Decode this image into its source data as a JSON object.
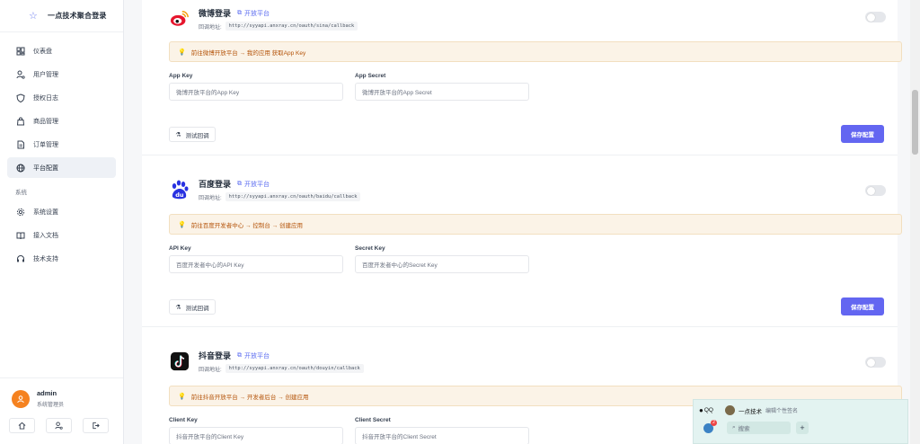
{
  "app": {
    "name": "一点技术聚合登录",
    "logo_icon": "star-icon"
  },
  "sidebar": {
    "items": [
      {
        "label": "仪表盘",
        "icon": "dashboard-icon"
      },
      {
        "label": "用户管理",
        "icon": "user-gear-icon"
      },
      {
        "label": "授权日志",
        "icon": "shield-icon"
      },
      {
        "label": "商品管理",
        "icon": "bag-icon"
      },
      {
        "label": "订单管理",
        "icon": "document-icon"
      },
      {
        "label": "平台配置",
        "icon": "globe-icon",
        "active": true
      }
    ],
    "group_label": "系统",
    "system_items": [
      {
        "label": "系统设置",
        "icon": "gear-icon"
      },
      {
        "label": "接入文档",
        "icon": "book-icon"
      },
      {
        "label": "技术支持",
        "icon": "headset-icon"
      }
    ],
    "user": {
      "name": "admin",
      "role": "系统管理员"
    }
  },
  "common": {
    "open_platform": "开放平台",
    "callback_label": "回调地址:",
    "test_callback": "测试回调",
    "save_config": "保存配置"
  },
  "platforms": [
    {
      "title": "微博登录",
      "callback_url": "http://syyapi.anxray.cn/oauth/sina/callback",
      "tip": "前往微博开放平台 → 我的应用 获取App Key",
      "field1_label": "App Key",
      "field1_placeholder": "微博开放平台的App Key",
      "field2_label": "App Secret",
      "field2_placeholder": "微博开放平台的App Secret",
      "enabled": false
    },
    {
      "title": "百度登录",
      "callback_url": "http://syyapi.anxray.cn/oauth/baidu/callback",
      "tip": "前往百度开发者中心 → 控制台 → 创建应用",
      "field1_label": "API Key",
      "field1_placeholder": "百度开发者中心的API Key",
      "field2_label": "Secret Key",
      "field2_placeholder": "百度开发者中心的Secret Key",
      "enabled": false
    },
    {
      "title": "抖音登录",
      "callback_url": "http://syyapi.anxray.cn/oauth/douyin/callback",
      "tip": "前往抖音开放平台 → 开发者后台 → 创建应用",
      "field1_label": "Client Key",
      "field1_placeholder": "抖音开放平台的Client Key",
      "field2_label": "Client Secret",
      "field2_placeholder": "抖音开放平台的Client Secret",
      "enabled": false
    }
  ],
  "qq_popup": {
    "app_label": "QQ",
    "nickname": "一点技术",
    "signature": "编辑个性签名",
    "badge": "2",
    "search_placeholder": "搜索",
    "add_label": "+"
  },
  "colors": {
    "accent": "#6366f1",
    "tip_bg": "#fbf3e7",
    "tip_text": "#b45309"
  }
}
